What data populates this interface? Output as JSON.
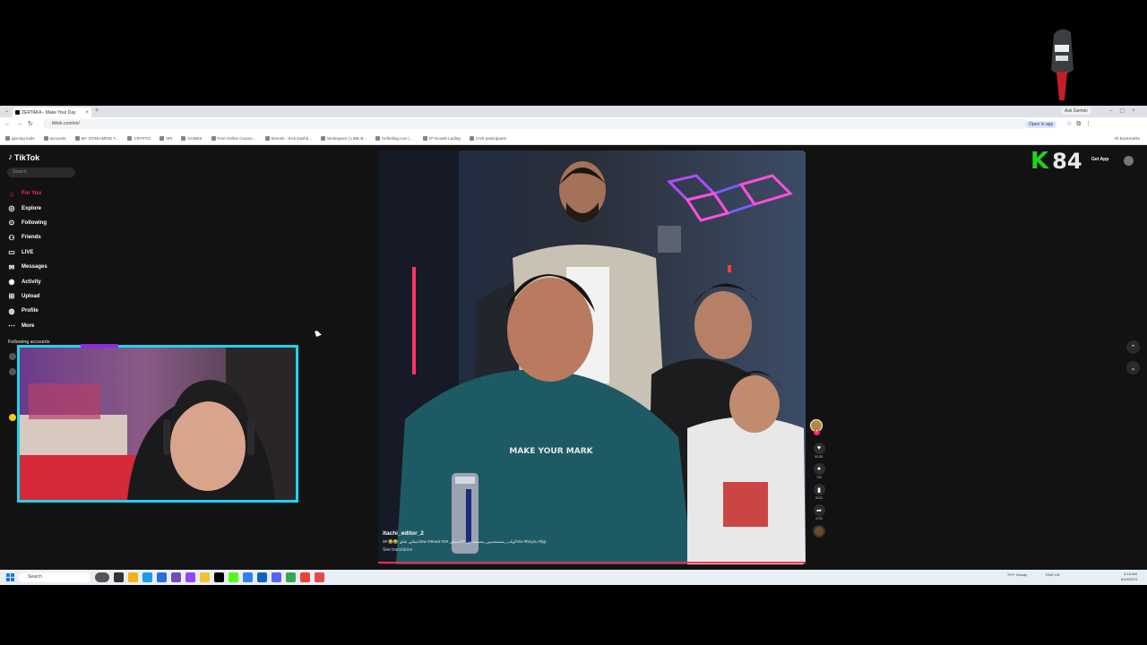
{
  "browser": {
    "tab_title": "ZERTAKA - Make Your Day",
    "ask_gemini": "Ask Gemini",
    "url": "tiktok.com/en/",
    "open_in_app": "Open in app",
    "bookmarks": [
      "gaming tools",
      "accounts",
      "MY STREAMING T...",
      "CRYPTO",
      "API",
      "GAMES",
      "Free Online Course...",
      "Simonk - Kick Dashb...",
      "Workspace | LINE B...",
      "Kefinding.com | ...",
      "IP Growth Lading",
      "LIVE participants"
    ],
    "all_bookmarks": "All Bookmarks"
  },
  "tiktok": {
    "logo": "TikTok",
    "search_placeholder": "Search",
    "nav": [
      {
        "label": "For You",
        "icon": "home-icon"
      },
      {
        "label": "Explore",
        "icon": "compass-icon"
      },
      {
        "label": "Following",
        "icon": "following-icon"
      },
      {
        "label": "Friends",
        "icon": "friends-icon"
      },
      {
        "label": "LIVE",
        "icon": "live-icon"
      },
      {
        "label": "Messages",
        "icon": "messages-icon"
      },
      {
        "label": "Activity",
        "icon": "activity-icon"
      },
      {
        "label": "Upload",
        "icon": "upload-icon"
      },
      {
        "label": "Profile",
        "icon": "profile-icon"
      },
      {
        "label": "More",
        "icon": "more-icon"
      }
    ],
    "following_heading": "Following accounts",
    "get_app": "Get App",
    "video": {
      "username": "itachi_editor_2",
      "caption": "اعملتي شاي 😂😂 #3mw #3mw3 #كوكب_مصمصمين_مصمصمين #اكسبلور #3mw #foryou #fyp",
      "see_translation": "See translation",
      "shirt_text": "MAKE YOUR MARK",
      "likes": "53.3K",
      "comments": "720",
      "saves": "5124",
      "shares": "2723"
    }
  },
  "overlay": {
    "score_letter": "K",
    "score_value": "84"
  },
  "taskbar": {
    "search_placeholder": "Search",
    "weather": "79°F Cloudy",
    "lang": "ENG US",
    "time": "4:15 AM",
    "date": "8/19/2024"
  },
  "colors": {
    "accent": "#fe2c55",
    "webcam_border": "#17d6f0",
    "score_green": "#22d11f"
  }
}
